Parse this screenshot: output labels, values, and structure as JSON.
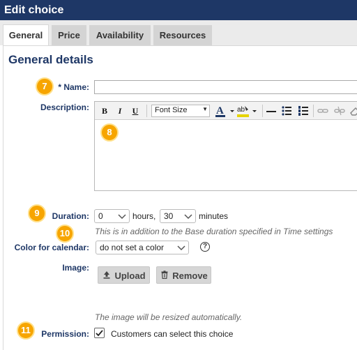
{
  "window": {
    "title": "Edit choice"
  },
  "tabs": [
    {
      "label": "General"
    },
    {
      "label": "Price"
    },
    {
      "label": "Availability"
    },
    {
      "label": "Resources"
    }
  ],
  "section": {
    "title": "General details"
  },
  "badges": [
    "7",
    "8",
    "9",
    "10",
    "11"
  ],
  "fields": {
    "name": {
      "label": "* Name:",
      "value": ""
    },
    "description": {
      "label": "Description:",
      "value": ""
    },
    "duration": {
      "label": "Duration:",
      "hours_value": "0",
      "hours_unit": "hours,",
      "minutes_value": "30",
      "minutes_unit": "minutes",
      "hint": "This is in addition to the Base duration specified in Time settings"
    },
    "color": {
      "label": "Color for calendar:",
      "value": "do not set a color",
      "help": "?"
    },
    "image": {
      "label": "Image:",
      "upload_label": "Upload",
      "remove_label": "Remove",
      "hint": "The image will be resized automatically."
    },
    "permission": {
      "label": "Permission:",
      "checked": true,
      "option": "Customers can select this choice"
    }
  },
  "editor_toolbar": {
    "bold": "B",
    "italic": "I",
    "underline": "U",
    "font_size": "Font Size"
  },
  "colors": {
    "brand": "#1e3766",
    "badge": "#f7a500"
  }
}
